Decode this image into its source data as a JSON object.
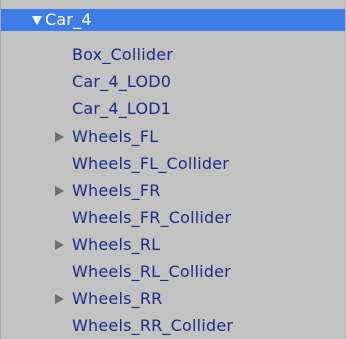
{
  "hierarchy": {
    "root": {
      "label": "Car_4",
      "expanded": true,
      "selected": true
    },
    "items": [
      {
        "label": "Box_Collider",
        "expandable": false
      },
      {
        "label": "Car_4_LOD0",
        "expandable": false
      },
      {
        "label": "Car_4_LOD1",
        "expandable": false
      },
      {
        "label": "Wheels_FL",
        "expandable": true
      },
      {
        "label": "Wheels_FL_Collider",
        "expandable": false
      },
      {
        "label": "Wheels_FR",
        "expandable": true
      },
      {
        "label": "Wheels_FR_Collider",
        "expandable": false
      },
      {
        "label": "Wheels_RL",
        "expandable": true
      },
      {
        "label": "Wheels_RL_Collider",
        "expandable": false
      },
      {
        "label": "Wheels_RR",
        "expandable": true
      },
      {
        "label": "Wheels_RR_Collider",
        "expandable": false
      }
    ],
    "colors": {
      "panel_background": "#c2c2c2",
      "selection": "#3e7de6",
      "text": "#1a2d86",
      "selected_text": "#ffffff",
      "collapsed_arrow": "#6d6d6d"
    },
    "icons": {
      "expanded_arrow": "triangle-down-icon",
      "collapsed_arrow": "triangle-right-icon"
    }
  }
}
